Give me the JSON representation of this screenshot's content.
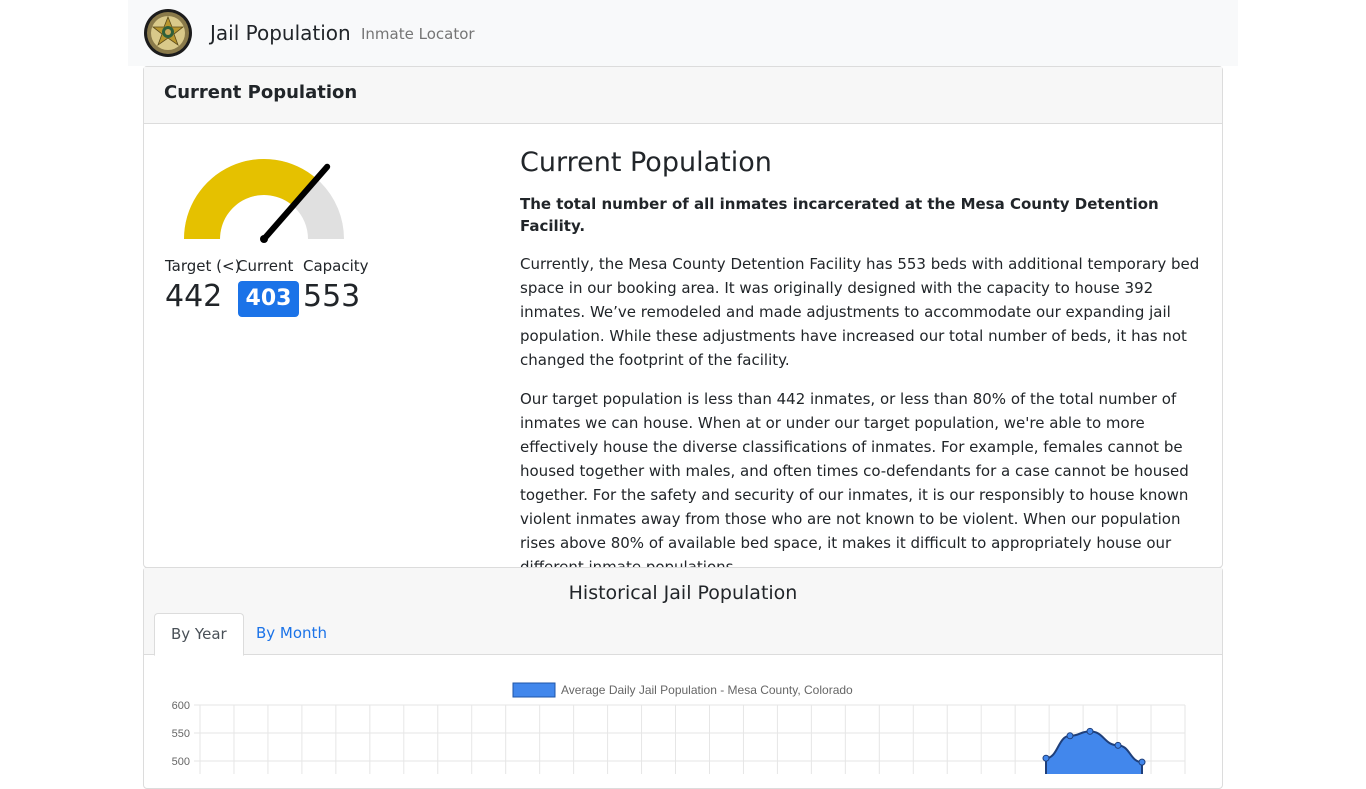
{
  "navbar": {
    "title": "Jail Population",
    "links": [
      "Inmate Locator"
    ]
  },
  "current_card": {
    "header": "Current Population",
    "gauge": {
      "labels": {
        "target": "Target (<)",
        "current": "Current",
        "capacity": "Capacity"
      },
      "target": "442",
      "current": "403",
      "capacity": "553",
      "current_value": 403,
      "capacity_value": 553,
      "colors": {
        "fill": "#e5c100",
        "track": "#e0e0e0",
        "needle": "#000000",
        "badge": "#1b73e8"
      }
    },
    "heading": "Current Population",
    "lead": "The total number of all inmates incarcerated at the Mesa County Detention Facility.",
    "paragraphs": [
      "Currently, the Mesa County Detention Facility has 553 beds with additional temporary bed space in our booking area. It was originally designed with the capacity to house 392 inmates. We’ve remodeled and made adjustments to accommodate our expanding jail population. While these adjustments have increased our total number of beds, it has not changed the footprint of the facility.",
      "Our target population is less than 442 inmates, or less than 80% of the total number of inmates we can house. When at or under our target population, we're able to more effectively house the diverse classifications of inmates. For example, females cannot be housed together with males, and often times co-defendants for a case cannot be housed together. For the safety and security of our inmates, it is our responsibly to house known violent inmates away from those who are not known to be violent. When our population rises above 80% of available bed space, it makes it difficult to appropriately house our different inmate populations."
    ]
  },
  "history_card": {
    "title": "Historical Jail Population",
    "tabs": [
      "By Year",
      "By Month"
    ],
    "active_tab": "By Year"
  },
  "chart_data": {
    "type": "area",
    "legend": "Average Daily Jail Population - Mesa County, Colorado",
    "legend_position": "top",
    "y_ticks": [
      "600",
      "550",
      "500"
    ],
    "ylim": [
      500,
      600
    ],
    "grid": true,
    "color": "#4287ec",
    "points": [
      {
        "x": 0.0,
        "y": 505
      },
      {
        "x": 0.3,
        "y": 545
      },
      {
        "x": 0.55,
        "y": 553
      },
      {
        "x": 0.9,
        "y": 528
      },
      {
        "x": 1.2,
        "y": 498
      }
    ]
  }
}
